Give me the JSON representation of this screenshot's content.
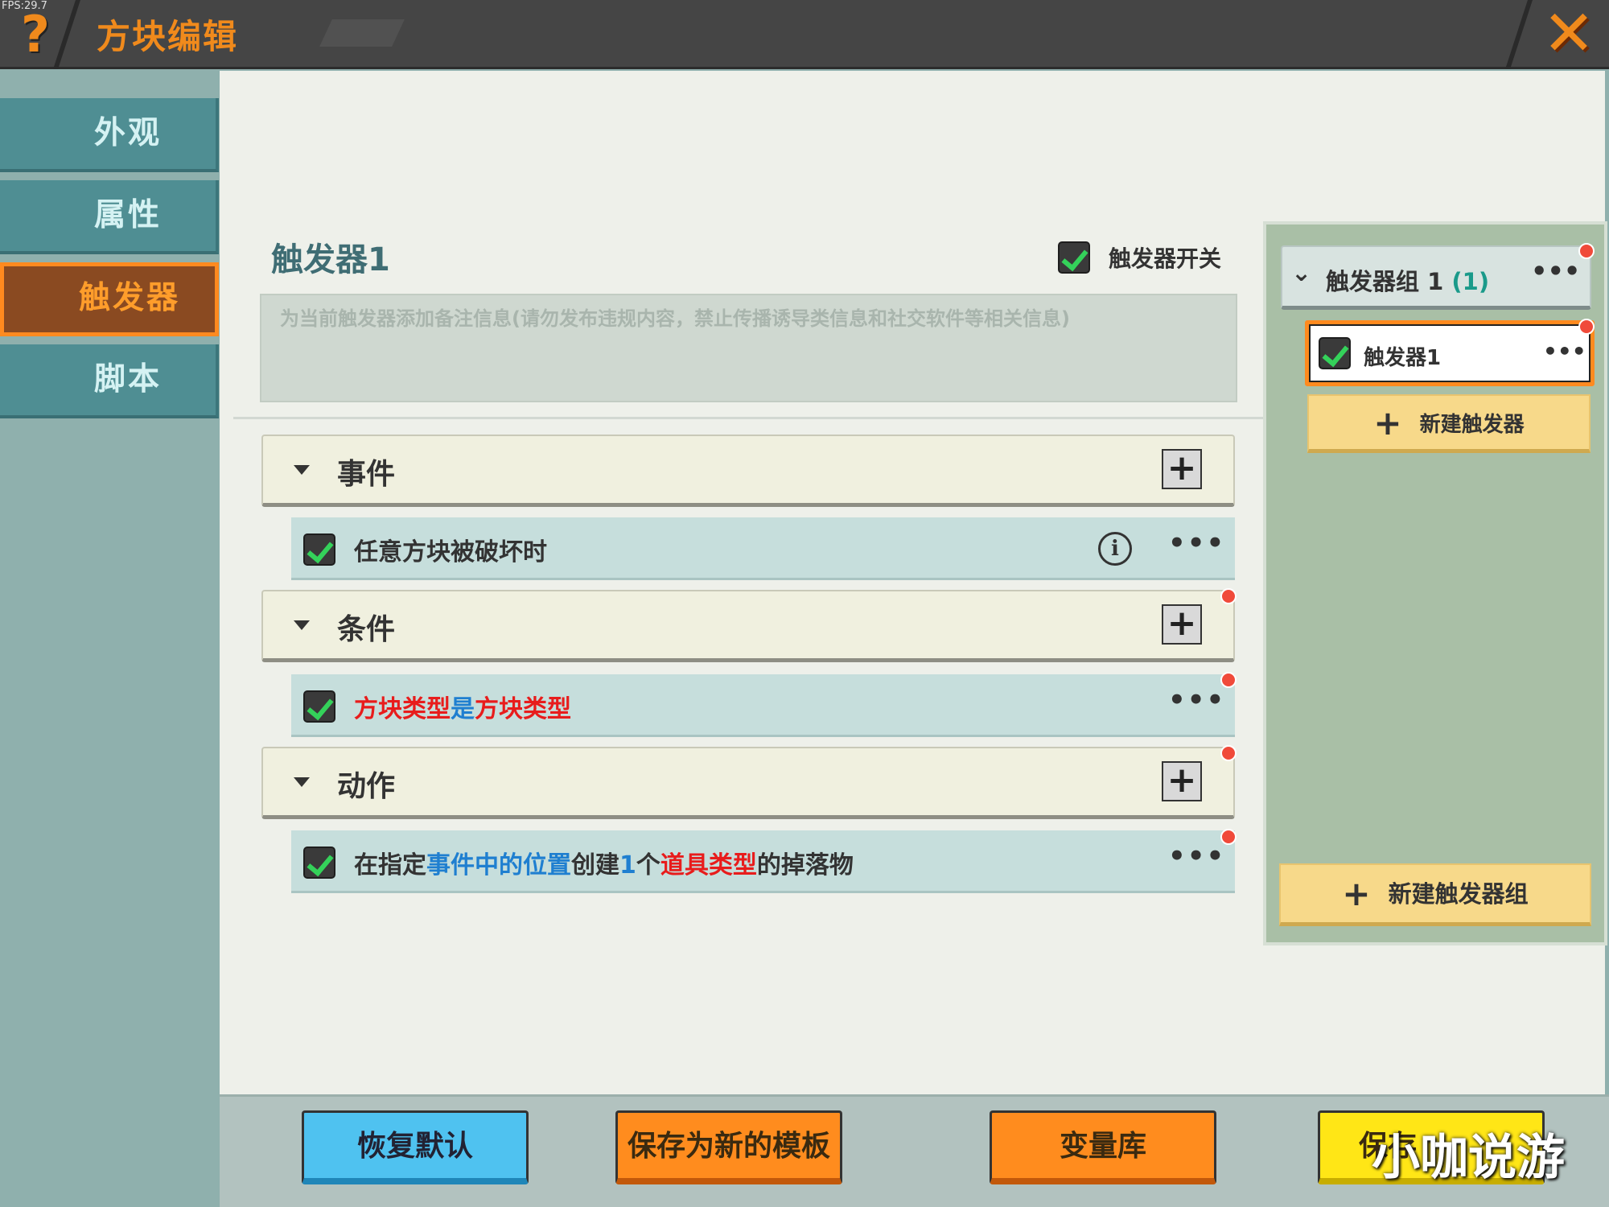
{
  "window": {
    "fps": "FPS:29.7",
    "title": "方块编辑"
  },
  "sidebar": {
    "items": [
      {
        "label": "外观"
      },
      {
        "label": "属性"
      },
      {
        "label": "触发器",
        "active": true
      },
      {
        "label": "脚本"
      }
    ]
  },
  "trigger": {
    "name": "触发器1",
    "switch_label": "触发器开关",
    "switch_checked": true,
    "note_placeholder": "为当前触发器添加备注信息(请勿发布违规内容，禁止传播诱导类信息和社交软件等相关信息)"
  },
  "sections": {
    "event": {
      "label": "事件",
      "row": {
        "text": "任意方块被破坏时",
        "more": "•••"
      }
    },
    "condition": {
      "label": "条件",
      "row": {
        "p1": "方块类型",
        "p2": "是",
        "p3": "方块类型",
        "more": "•••"
      }
    },
    "action": {
      "label": "动作",
      "row": {
        "p1": "在指定",
        "p2": "事件中的位置",
        "p3": "创建",
        "p4": "1",
        "p5": "个",
        "p6": "道具类型",
        "p7": "的掉落物",
        "more": "•••"
      }
    }
  },
  "right_panel": {
    "group_label": "触发器组 1",
    "group_count": "(1)",
    "group_more": "•••",
    "trigger_item": "触发器1",
    "trigger_more": "•••",
    "new_trigger": "新建触发器",
    "new_group": "新建触发器组"
  },
  "footer": {
    "reset": "恢复默认",
    "save_template": "保存为新的模板",
    "variables": "变量库",
    "save": "保存"
  },
  "watermark": "小咖说游",
  "colors": {
    "accent_orange": "#ff8a1f",
    "text_red": "#e81c1c",
    "text_blue": "#1f7fd0",
    "sidebar_teal": "#4f8e93"
  }
}
